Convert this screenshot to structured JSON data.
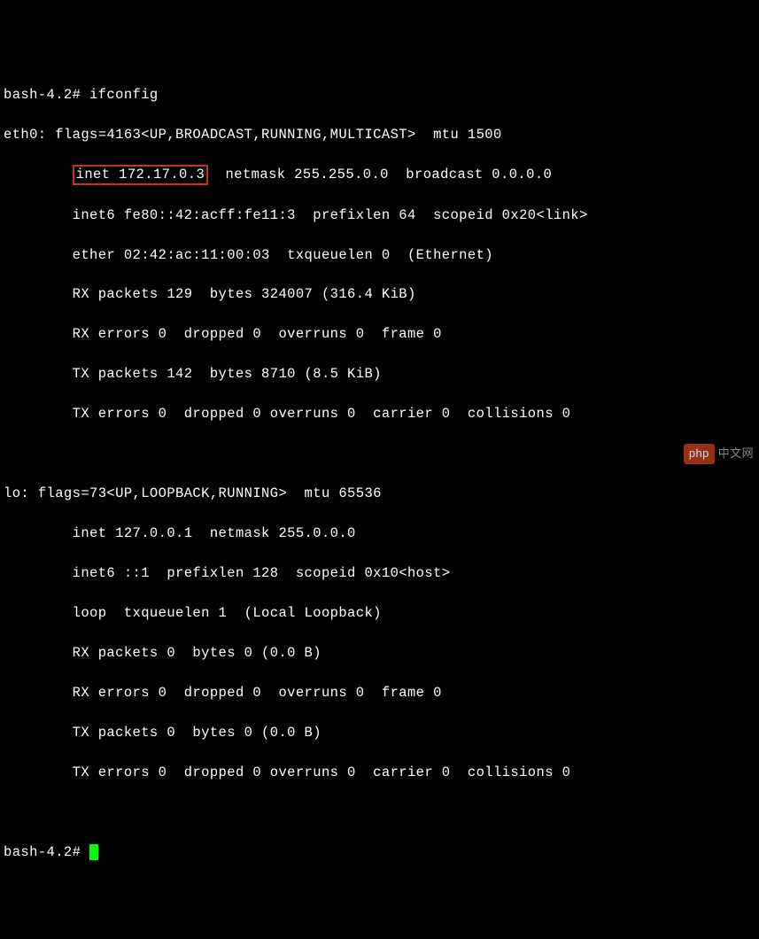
{
  "prompt1": "bash-4.2# ",
  "cmd1": "ifconfig",
  "eth0": {
    "header": "eth0: flags=4163<UP,BROADCAST,RUNNING,MULTICAST>  mtu 1500",
    "inet_highlight": "inet 172.17.0.3",
    "inet_rest": "  netmask 255.255.0.0  broadcast 0.0.0.0",
    "inet6": "        inet6 fe80::42:acff:fe11:3  prefixlen 64  scopeid 0x20<link>",
    "ether": "        ether 02:42:ac:11:00:03  txqueuelen 0  (Ethernet)",
    "rx_packets": "        RX packets 129  bytes 324007 (316.4 KiB)",
    "rx_errors": "        RX errors 0  dropped 0  overruns 0  frame 0",
    "tx_packets": "        TX packets 142  bytes 8710 (8.5 KiB)",
    "tx_errors": "        TX errors 0  dropped 0 overruns 0  carrier 0  collisions 0"
  },
  "lo": {
    "header": "lo: flags=73<UP,LOOPBACK,RUNNING>  mtu 65536",
    "inet": "        inet 127.0.0.1  netmask 255.0.0.0",
    "inet6": "        inet6 ::1  prefixlen 128  scopeid 0x10<host>",
    "loop": "        loop  txqueuelen 1  (Local Loopback)",
    "rx_packets": "        RX packets 0  bytes 0 (0.0 B)",
    "rx_errors": "        RX errors 0  dropped 0  overruns 0  frame 0",
    "tx_packets": "        TX packets 0  bytes 0 (0.0 B)",
    "tx_errors": "        TX errors 0  dropped 0 overruns 0  carrier 0  collisions 0"
  },
  "prompt2": "bash-4.2# ",
  "watermark": {
    "badge": "php",
    "text": "中文网"
  }
}
